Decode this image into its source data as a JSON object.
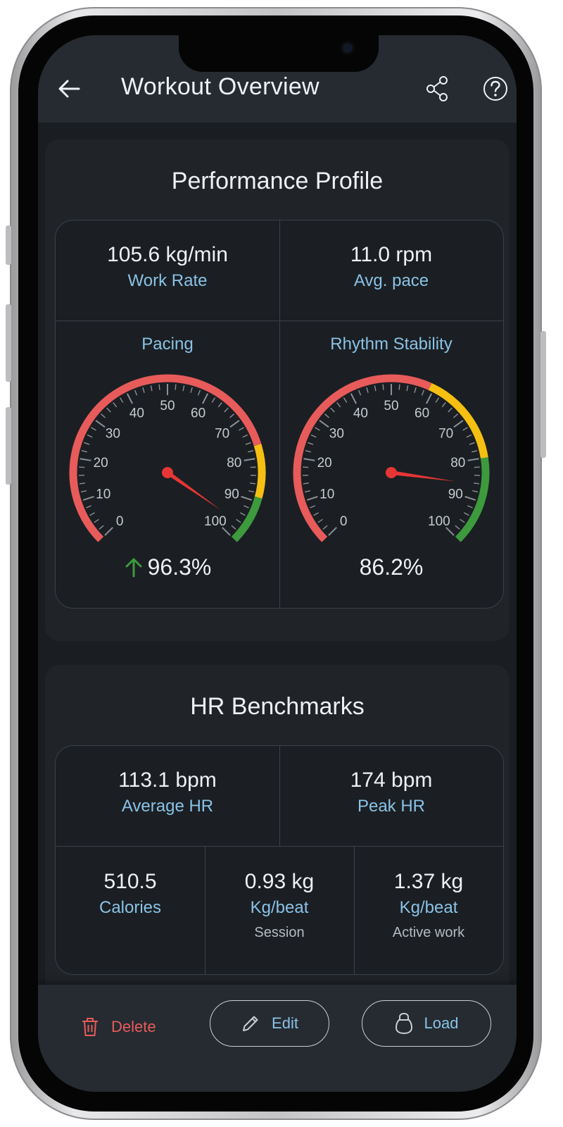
{
  "appbar": {
    "title": "Workout Overview"
  },
  "performance": {
    "title": "Performance Profile",
    "work_rate": {
      "value": "105.6 kg/min",
      "label": "Work Rate"
    },
    "avg_pace": {
      "value": "11.0 rpm",
      "label": "Avg. pace"
    },
    "pacing": {
      "title": "Pacing",
      "value_text": "96.3%",
      "value": 96.3,
      "zones": [
        {
          "from": 0,
          "to": 77,
          "color": "#e85b5b"
        },
        {
          "from": 77,
          "to": 89,
          "color": "#f5c012"
        },
        {
          "from": 89,
          "to": 100,
          "color": "#3d9a3d"
        }
      ]
    },
    "rhythm": {
      "title": "Rhythm Stability",
      "value_text": "86.2%",
      "value": 86.2,
      "zones": [
        {
          "from": 0,
          "to": 59,
          "color": "#e85b5b"
        },
        {
          "from": 59,
          "to": 80,
          "color": "#f5c012"
        },
        {
          "from": 80,
          "to": 100,
          "color": "#3d9a3d"
        }
      ]
    },
    "gauge_ticks": [
      "0",
      "10",
      "20",
      "30",
      "40",
      "50",
      "60",
      "70",
      "80",
      "90",
      "100"
    ]
  },
  "hr": {
    "title": "HR Benchmarks",
    "average": {
      "value": "113.1 bpm",
      "label": "Average HR"
    },
    "peak": {
      "value": "174 bpm",
      "label": "Peak HR"
    },
    "calories": {
      "value": "510.5",
      "label": "Calories"
    },
    "kg_session": {
      "value": "0.93 kg",
      "label": "Kg/beat",
      "sub": "Session"
    },
    "kg_active": {
      "value": "1.37 kg",
      "label": "Kg/beat",
      "sub": "Active work"
    }
  },
  "actions": {
    "delete": "Delete",
    "edit": "Edit",
    "load": "Load"
  },
  "colors": {
    "accent": "#8ac2e6",
    "danger": "#e85b5b",
    "up_arrow": "#3d9a3d",
    "needle": "#e83535"
  }
}
